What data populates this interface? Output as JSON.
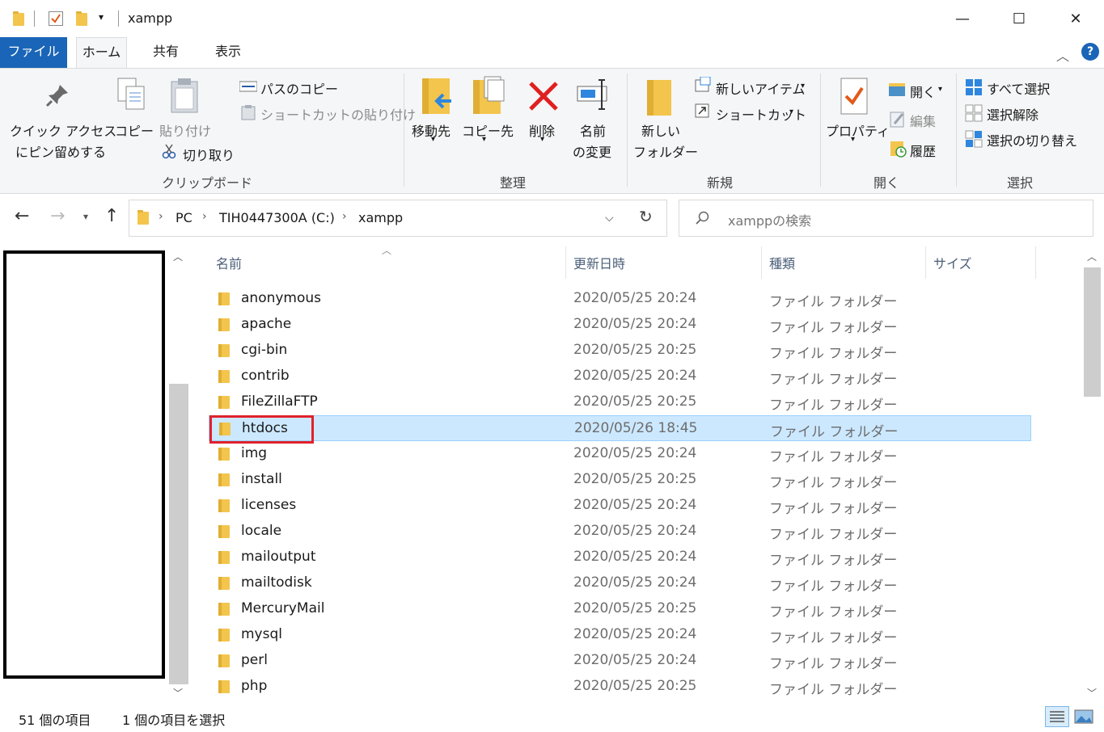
{
  "window": {
    "title": "xampp",
    "minimize": "—",
    "maximize": "☐",
    "close": "✕"
  },
  "tabs": {
    "file": "ファイル",
    "home": "ホーム",
    "share": "共有",
    "view": "表示"
  },
  "ribbon": {
    "clipboard": {
      "pin_line1": "クイック アクセス",
      "pin_line2": "にピン留めする",
      "copy": "コピー",
      "paste": "貼り付け",
      "copy_path": "パスのコピー",
      "paste_shortcut": "ショートカットの貼り付け",
      "cut": "切り取り",
      "group": "クリップボード"
    },
    "organize": {
      "move_to": "移動先",
      "copy_to": "コピー先",
      "delete": "削除",
      "rename_line1": "名前",
      "rename_line2": "の変更",
      "group": "整理"
    },
    "new": {
      "new_folder_line1": "新しい",
      "new_folder_line2": "フォルダー",
      "new_item": "新しいアイテム",
      "shortcut": "ショートカット",
      "group": "新規"
    },
    "open": {
      "properties": "プロパティ",
      "open": "開く",
      "edit": "編集",
      "history": "履歴",
      "group": "開く"
    },
    "select": {
      "select_all": "すべて選択",
      "select_none": "選択解除",
      "invert": "選択の切り替え",
      "group": "選択"
    }
  },
  "address": {
    "crumbs": [
      "PC",
      "TIH0447300A (C:)",
      "xampp"
    ],
    "search_placeholder": "xamppの検索"
  },
  "columns": {
    "name": "名前",
    "date": "更新日時",
    "type": "種類",
    "size": "サイズ"
  },
  "files": [
    {
      "name": "anonymous",
      "date": "2020/05/25 20:24",
      "type": "ファイル フォルダー"
    },
    {
      "name": "apache",
      "date": "2020/05/25 20:24",
      "type": "ファイル フォルダー"
    },
    {
      "name": "cgi-bin",
      "date": "2020/05/25 20:25",
      "type": "ファイル フォルダー"
    },
    {
      "name": "contrib",
      "date": "2020/05/25 20:24",
      "type": "ファイル フォルダー"
    },
    {
      "name": "FileZillaFTP",
      "date": "2020/05/25 20:25",
      "type": "ファイル フォルダー"
    },
    {
      "name": "htdocs",
      "date": "2020/05/26 18:45",
      "type": "ファイル フォルダー"
    },
    {
      "name": "img",
      "date": "2020/05/25 20:24",
      "type": "ファイル フォルダー"
    },
    {
      "name": "install",
      "date": "2020/05/25 20:25",
      "type": "ファイル フォルダー"
    },
    {
      "name": "licenses",
      "date": "2020/05/25 20:24",
      "type": "ファイル フォルダー"
    },
    {
      "name": "locale",
      "date": "2020/05/25 20:24",
      "type": "ファイル フォルダー"
    },
    {
      "name": "mailoutput",
      "date": "2020/05/25 20:24",
      "type": "ファイル フォルダー"
    },
    {
      "name": "mailtodisk",
      "date": "2020/05/25 20:24",
      "type": "ファイル フォルダー"
    },
    {
      "name": "MercuryMail",
      "date": "2020/05/25 20:25",
      "type": "ファイル フォルダー"
    },
    {
      "name": "mysql",
      "date": "2020/05/25 20:24",
      "type": "ファイル フォルダー"
    },
    {
      "name": "perl",
      "date": "2020/05/25 20:24",
      "type": "ファイル フォルダー"
    },
    {
      "name": "php",
      "date": "2020/05/25 20:25",
      "type": "ファイル フォルダー"
    }
  ],
  "selected_file": "htdocs",
  "status": {
    "count": "51 個の項目",
    "selection": "1 個の項目を選択"
  },
  "colors": {
    "file_tab": "#1a65b7",
    "selection": "#cce8ff",
    "highlight_box": "#e0212b",
    "folder": "#f3c54d"
  }
}
